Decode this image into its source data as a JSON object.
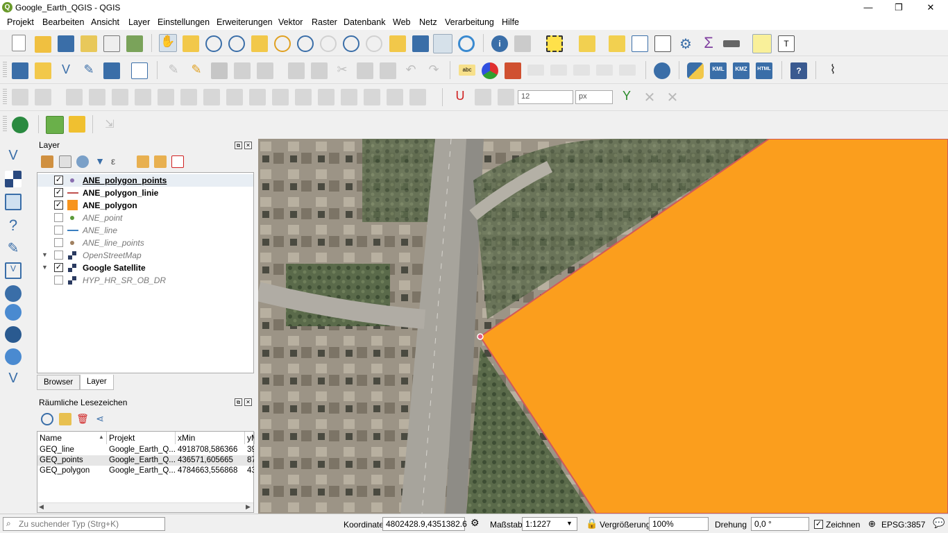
{
  "window": {
    "title": "Google_Earth_QGIS - QGIS",
    "minimize": "—",
    "maximize": "❐",
    "close": "✕"
  },
  "menu": [
    "Projekt",
    "Bearbeiten",
    "Ansicht",
    "Layer",
    "Einstellungen",
    "Erweiterungen",
    "Vektor",
    "Raster",
    "Datenbank",
    "Web",
    "Netz",
    "Verarbeitung",
    "Hilfe"
  ],
  "toolbar": {
    "snap_value": "12",
    "snap_unit": "px",
    "kml": "KML",
    "kmz": "KMZ",
    "html": "HTML",
    "abc": "abc"
  },
  "layers_panel": {
    "title": "Layer",
    "layers": [
      {
        "name": "ANE_polygon_points",
        "checked": true,
        "style": "b",
        "symbol": "point",
        "color": "#8a6fb0"
      },
      {
        "name": "ANE_polygon_linie",
        "checked": true,
        "style": "b",
        "symbol": "line",
        "color": "#c0504d"
      },
      {
        "name": "ANE_polygon",
        "checked": true,
        "style": "b",
        "symbol": "fill",
        "color": "#f7941d"
      },
      {
        "name": "ANE_point",
        "checked": false,
        "style": "i",
        "symbol": "point",
        "color": "#5b9a3a"
      },
      {
        "name": "ANE_line",
        "checked": false,
        "style": "i",
        "symbol": "line",
        "color": "#3a7fc0"
      },
      {
        "name": "ANE_line_points",
        "checked": false,
        "style": "i",
        "symbol": "point",
        "color": "#a08060"
      },
      {
        "name": "OpenStreetMap",
        "checked": false,
        "style": "i",
        "symbol": "raster",
        "color": "#336"
      },
      {
        "name": "Google Satellite",
        "checked": true,
        "style": "b",
        "symbol": "raster",
        "color": "#336"
      },
      {
        "name": "HYP_HR_SR_OB_DR",
        "checked": false,
        "style": "i",
        "symbol": "raster",
        "color": "#336"
      }
    ],
    "tabs": [
      "Browser",
      "Layer"
    ]
  },
  "bookmarks_panel": {
    "title": "Räumliche Lesezeichen",
    "columns": [
      "Name",
      "Projekt",
      "xMin",
      "yM"
    ],
    "rows": [
      [
        "GEQ_line",
        "Google_Earth_Q...",
        "4918708,586366",
        "39"
      ],
      [
        "GEQ_points",
        "Google_Earth_Q...",
        "436571,605665",
        "87"
      ],
      [
        "GEQ_polygon",
        "Google_Earth_Q...",
        "4784663,556868",
        "43"
      ]
    ]
  },
  "statusbar": {
    "search_placeholder": "Zu suchender Typ (Strg+K)",
    "coord_label": "Koordinate",
    "coord_value": "4802428.9,4351382.6",
    "scale_label": "Maßstab",
    "scale_value": "1:1227",
    "zoom_label": "Vergrößerung",
    "zoom_value": "100%",
    "rotation_label": "Drehung",
    "rotation_value": "0,0 °",
    "render_label": "Zeichnen",
    "crs": "EPSG:3857"
  },
  "colors": {
    "polygon_fill": "#fb9e1d",
    "polygon_outline": "#d05a5a",
    "vertex": "#e06080"
  }
}
